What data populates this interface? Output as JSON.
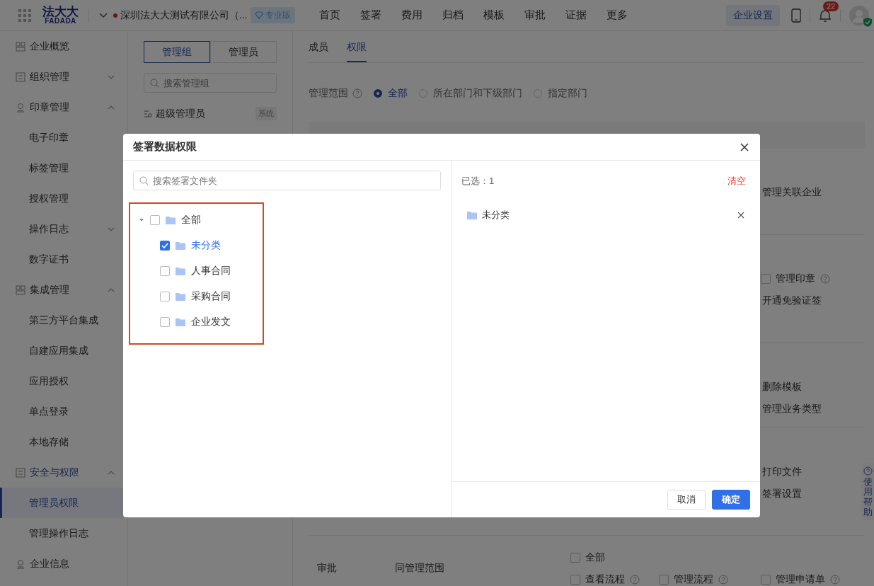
{
  "topbar": {
    "logo": {
      "name": "法大大",
      "latin": "FADADA"
    },
    "company": "深圳法大大测试有限公司（...",
    "edition": "专业版",
    "nav": [
      {
        "label": "首页"
      },
      {
        "label": "签署"
      },
      {
        "label": "费用"
      },
      {
        "label": "归档"
      },
      {
        "label": "模板"
      },
      {
        "label": "审批"
      },
      {
        "label": "证据"
      },
      {
        "label": "更多"
      }
    ],
    "settings_button": "企业设置",
    "notification_count": "22"
  },
  "sidebar": {
    "items": [
      {
        "label": "企业概览",
        "selected": false
      },
      {
        "label": "组织管理",
        "selected": false,
        "expanded": false
      },
      {
        "label": "印章管理",
        "selected": false,
        "expanded": true,
        "children": [
          {
            "label": "电子印章",
            "selected": false
          },
          {
            "label": "标签管理",
            "selected": false
          },
          {
            "label": "授权管理",
            "selected": false
          },
          {
            "label": "操作日志",
            "selected": false,
            "expanded": false
          },
          {
            "label": "数字证书",
            "selected": false
          }
        ]
      },
      {
        "label": "集成管理",
        "selected": false,
        "expanded": true,
        "children": [
          {
            "label": "第三方平台集成",
            "selected": false
          },
          {
            "label": "自建应用集成",
            "selected": false
          },
          {
            "label": "应用授权",
            "selected": false
          },
          {
            "label": "单点登录",
            "selected": false
          },
          {
            "label": "本地存储",
            "selected": false
          }
        ]
      },
      {
        "label": "安全与权限",
        "selected": false,
        "expanded": true,
        "children": [
          {
            "label": "管理员权限",
            "selected": true
          },
          {
            "label": "管理操作日志",
            "selected": false
          }
        ]
      },
      {
        "label": "企业信息",
        "selected": false
      }
    ]
  },
  "groups": {
    "segments": [
      {
        "label": "管理组",
        "selected": true
      },
      {
        "label": "管理员",
        "selected": false
      }
    ],
    "search": {
      "placeholder": "搜索管理组"
    },
    "items": [
      {
        "label": "超级管理员",
        "tag": "系统"
      }
    ]
  },
  "main": {
    "tabs": [
      {
        "label": "成员",
        "selected": false
      },
      {
        "label": "权限",
        "selected": true
      }
    ],
    "scope": {
      "label": "管理范围",
      "options": [
        {
          "label": "全部",
          "selected": true
        },
        {
          "label": "所在部门和下级部门",
          "selected": false
        },
        {
          "label": "指定部门",
          "selected": false
        }
      ]
    },
    "sections": [
      {
        "items": [
          {
            "label": "管理关联企业"
          }
        ]
      },
      {
        "items": [
          {
            "label": "管理印章",
            "checked": false,
            "help": true
          },
          {
            "label": "开通免验证签"
          }
        ]
      },
      {
        "items": [
          {
            "label": "删除模板"
          },
          {
            "label": "管理业务类型"
          }
        ]
      },
      {
        "items": [
          {
            "label": "打印文件"
          },
          {
            "label": "签署设置"
          }
        ]
      },
      {
        "function": "审批",
        "data_scope": "同管理范围",
        "items": [
          {
            "label": "全部",
            "checked": false
          },
          {
            "label": "查看流程",
            "checked": false,
            "help": true
          },
          {
            "label": "管理流程",
            "checked": false,
            "help": true
          },
          {
            "label": "管理申请单",
            "checked": false,
            "help": true
          }
        ]
      }
    ]
  },
  "help_tab": {
    "label": "使用帮助"
  },
  "dialog": {
    "title": "签署数据权限",
    "search": {
      "placeholder": "搜索签署文件夹"
    },
    "tree": [
      {
        "label": "全部",
        "checked": false,
        "expanded": true,
        "children": [
          {
            "label": "未分类",
            "checked": true
          },
          {
            "label": "人事合同",
            "checked": false
          },
          {
            "label": "采购合同",
            "checked": false
          },
          {
            "label": "企业发文",
            "checked": false
          }
        ]
      }
    ],
    "selected_count": "已选：1",
    "clear": "清空",
    "selected_items": [
      {
        "label": "未分类"
      }
    ],
    "buttons": [
      {
        "label": "取消",
        "kind": "secondary"
      },
      {
        "label": "确定",
        "kind": "primary"
      }
    ]
  }
}
